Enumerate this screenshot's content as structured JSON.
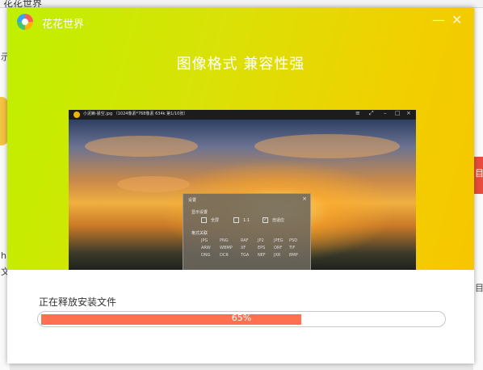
{
  "background": {
    "window_title": "花花世界",
    "fragment_1": "示",
    "fragment_2": "h",
    "fragment_3": "文",
    "fragment_4": "目",
    "fragment_5": "目"
  },
  "installer": {
    "app_name": "花花世界",
    "minimize": "—",
    "close": "✕",
    "headline": "图像格式  兼容性强",
    "preview": {
      "title": "小泥鳅-晨空.jpg （1024像素*768像素 634k 第1/10张）",
      "dialog": {
        "title": "设置",
        "close": "×",
        "display_section": "显示设置",
        "options": [
          "全屏",
          "1:1",
          "自适应"
        ],
        "checked_index": 2,
        "format_section": "格式关联",
        "formats": [
          "JPG",
          "PNG",
          "RAF",
          "JP2",
          "JPEG",
          "PSD",
          "ARW",
          "WBMP",
          "XF",
          "EPS",
          "ORF",
          "TIF",
          "DNG",
          "DCR",
          "TGA",
          "NEF",
          "JXR",
          "BMP"
        ]
      }
    },
    "status_text": "正在释放安装文件",
    "progress": 65,
    "progress_label": "65%",
    "colors": {
      "accent": "#ff7050",
      "hero_start": "#bff000",
      "hero_end": "#f7c600"
    }
  }
}
